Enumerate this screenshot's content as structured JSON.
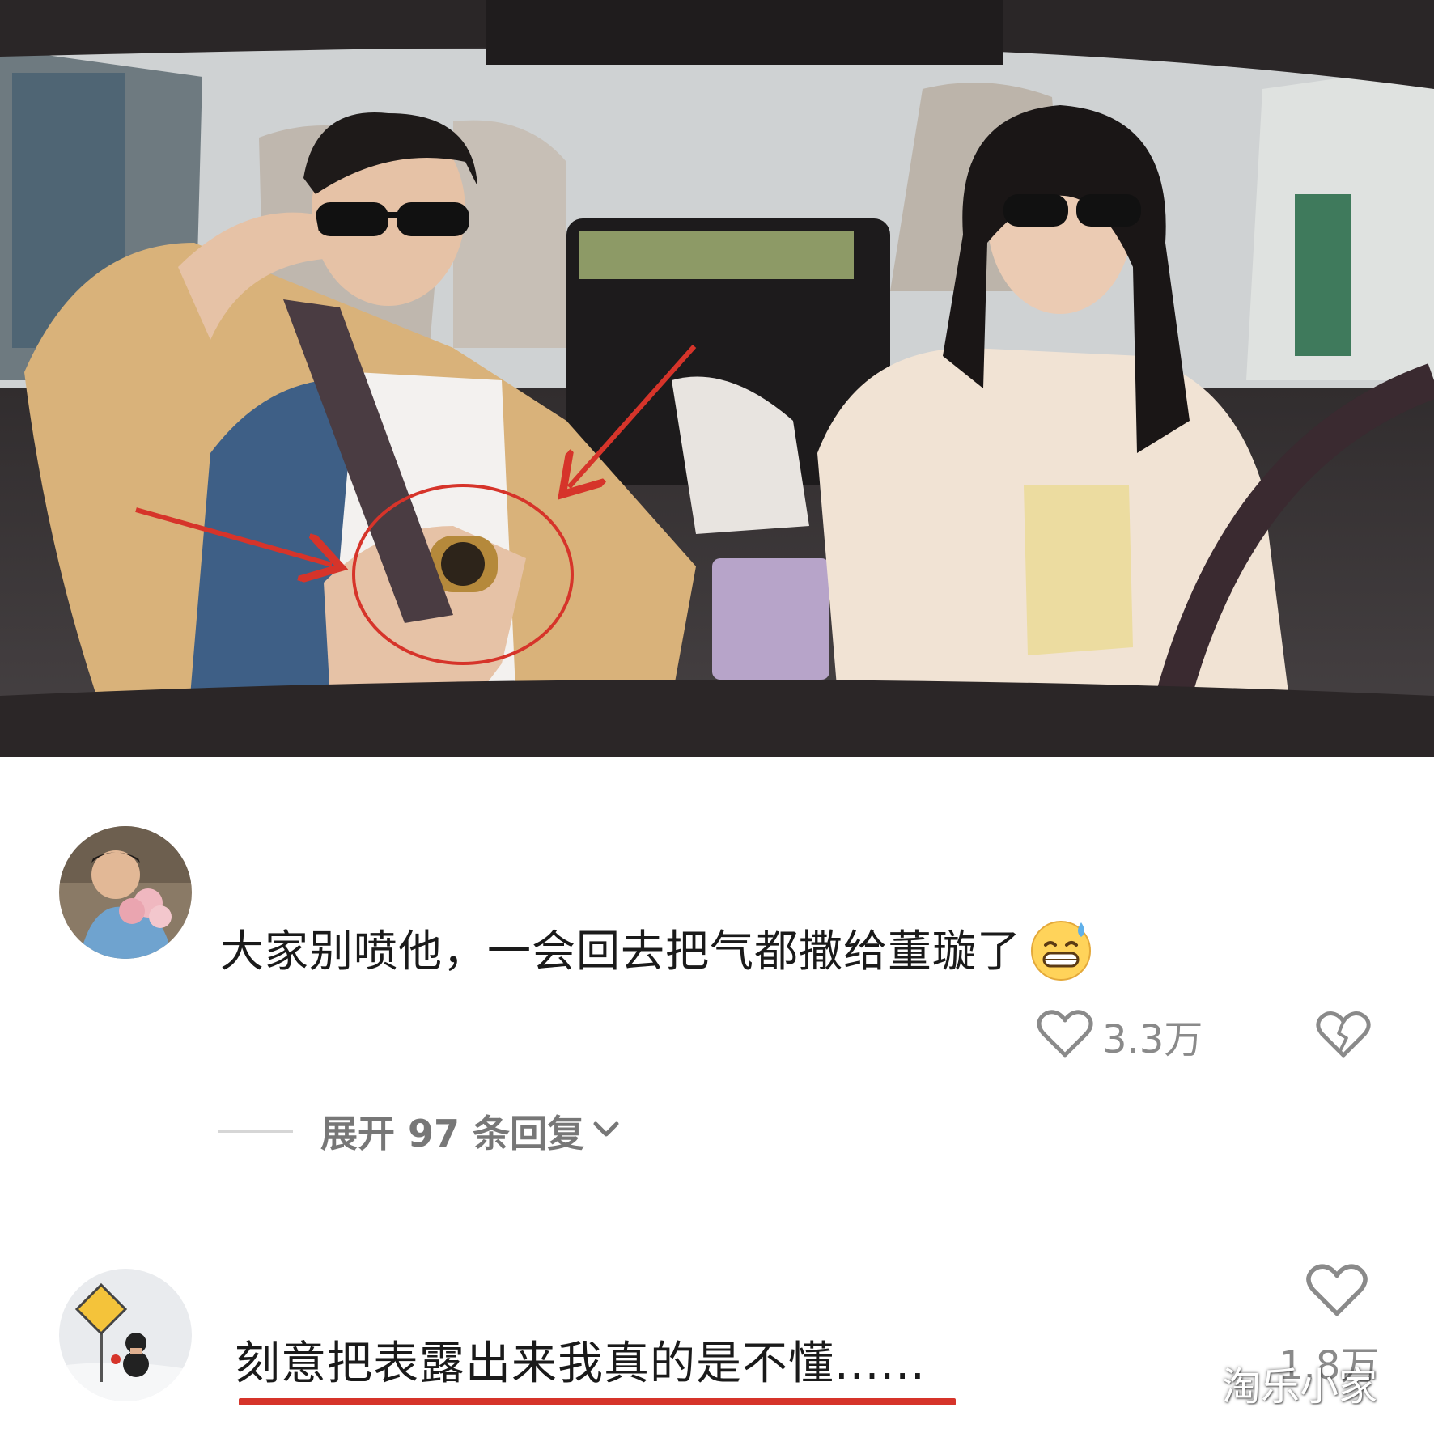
{
  "comments": [
    {
      "text": "大家别喷他，一会回去把气都撒给董璇了",
      "emoji": "grinning-sweat-emoji",
      "likes": "3.3万",
      "expand_label": "展开 97 条回复"
    },
    {
      "text": "刻意把表露出来我真的是不懂......",
      "likes": "1.8万"
    }
  ],
  "watermark": "淘乐小家",
  "colors": {
    "annotation_red": "#d6342a",
    "text_primary": "#1a1a1a",
    "text_secondary": "#8a8a8a"
  }
}
